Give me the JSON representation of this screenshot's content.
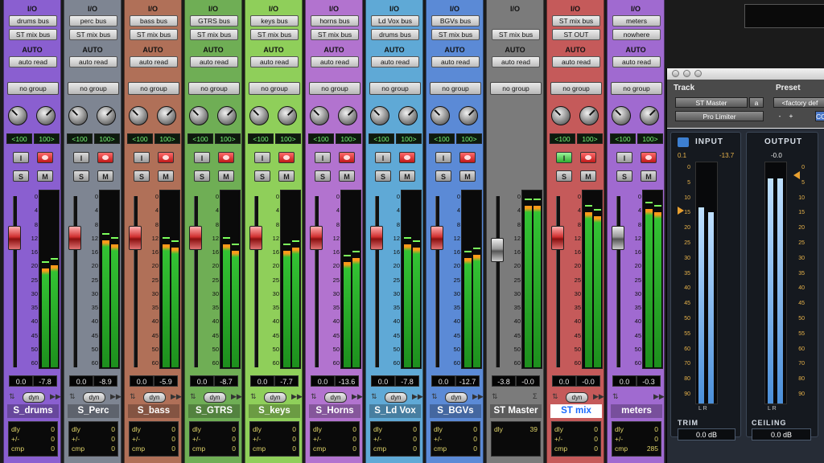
{
  "colors": {
    "selected_name": "#1a6bff"
  },
  "channels": [
    {
      "io": "I/O",
      "input": "drums bus",
      "output": "ST mix bus",
      "auto_label": "AUTO",
      "auto_mode": "auto read",
      "group": "no group",
      "pan_l": "<100",
      "pan_r": "100>",
      "vol": "0.0",
      "peak": "-7.8",
      "name": "S_drums",
      "dly": "0",
      "plus": "0",
      "cmp": "0",
      "color": "#8a5fd0",
      "rec": true,
      "inp_active": false,
      "fader": "red",
      "meter_level": [
        0.56,
        0.58
      ],
      "dyn": "dyn"
    },
    {
      "io": "I/O",
      "input": "perc bus",
      "output": "ST mix bus",
      "auto_label": "AUTO",
      "auto_mode": "auto read",
      "group": "no group",
      "pan_l": "<100",
      "pan_r": "100>",
      "vol": "0.0",
      "peak": "-8.9",
      "name": "S_Perc",
      "dly": "0",
      "plus": "0",
      "cmp": "0",
      "color": "#7e8592",
      "rec": true,
      "inp_active": false,
      "fader": "red",
      "meter_level": [
        0.72,
        0.7
      ],
      "dyn": "dyn"
    },
    {
      "io": "I/O",
      "input": "bass bus",
      "output": "ST mix bus",
      "auto_label": "AUTO",
      "auto_mode": "auto read",
      "group": "no group",
      "pan_l": "<100",
      "pan_r": "100>",
      "vol": "0.0",
      "peak": "-5.9",
      "name": "S_bass",
      "dly": "0",
      "plus": "0",
      "cmp": "0",
      "color": "#b07058",
      "rec": true,
      "inp_active": false,
      "fader": "red",
      "meter_level": [
        0.7,
        0.68
      ],
      "dyn": "dyn"
    },
    {
      "io": "I/O",
      "input": "GTRS bus",
      "output": "ST mix bus",
      "auto_label": "AUTO",
      "auto_mode": "auto read",
      "group": "no group",
      "pan_l": "<100",
      "pan_r": "100>",
      "vol": "0.0",
      "peak": "-8.7",
      "name": "S_GTRS",
      "dly": "0",
      "plus": "0",
      "cmp": "0",
      "color": "#6fae55",
      "rec": true,
      "inp_active": false,
      "fader": "red",
      "meter_level": [
        0.7,
        0.66
      ],
      "dyn": "dyn"
    },
    {
      "io": "I/O",
      "input": "keys bus",
      "output": "ST mix bus",
      "auto_label": "AUTO",
      "auto_mode": "auto read",
      "group": "no group",
      "pan_l": "<100",
      "pan_r": "100>",
      "vol": "0.0",
      "peak": "-7.7",
      "name": "S_keys",
      "dly": "0",
      "plus": "0",
      "cmp": "0",
      "color": "#8fcf5a",
      "rec": true,
      "inp_active": false,
      "fader": "red",
      "meter_level": [
        0.66,
        0.68
      ],
      "dyn": "dyn"
    },
    {
      "io": "I/O",
      "input": "horns bus",
      "output": "ST mix bus",
      "auto_label": "AUTO",
      "auto_mode": "auto read",
      "group": "no group",
      "pan_l": "<100",
      "pan_r": "100>",
      "vol": "0.0",
      "peak": "-13.6",
      "name": "S_Horns",
      "dly": "0",
      "plus": "0",
      "cmp": "0",
      "color": "#b273cf",
      "rec": true,
      "inp_active": false,
      "fader": "red",
      "meter_level": [
        0.6,
        0.62
      ],
      "dyn": "dyn"
    },
    {
      "io": "I/O",
      "input": "Ld Vox bus",
      "output": "drums bus",
      "auto_label": "AUTO",
      "auto_mode": "auto read",
      "group": "no group",
      "pan_l": "<100",
      "pan_r": "100>",
      "vol": "0.0",
      "peak": "-7.8",
      "name": "S_Ld Vox",
      "dly": "0",
      "plus": "0",
      "cmp": "0",
      "color": "#5fa9d6",
      "rec": true,
      "inp_active": false,
      "fader": "red",
      "meter_level": [
        0.7,
        0.68
      ],
      "dyn": "dyn"
    },
    {
      "io": "I/O",
      "input": "BGVs bus",
      "output": "ST mix bus",
      "auto_label": "AUTO",
      "auto_mode": "auto read",
      "group": "no group",
      "pan_l": "<100",
      "pan_r": "100>",
      "vol": "0.0",
      "peak": "-12.7",
      "name": "S_BGVs",
      "dly": "0",
      "plus": "0",
      "cmp": "0",
      "color": "#5b8ad6",
      "rec": true,
      "inp_active": false,
      "fader": "red",
      "meter_level": [
        0.62,
        0.64
      ],
      "dyn": "dyn"
    },
    {
      "io": "I/O",
      "input": "",
      "output": "ST mix bus",
      "auto_label": "AUTO",
      "auto_mode": "auto read",
      "group": "no group",
      "pan_l": "",
      "pan_r": "",
      "vol": "-3.8",
      "peak": "-0.0",
      "name": "ST Master",
      "dly": "39",
      "plus": "",
      "cmp": "",
      "color": "#7b7b7b",
      "rec": false,
      "inp_active": false,
      "fader": "gray",
      "meter_level": [
        0.92,
        0.92
      ],
      "dyn": ""
    },
    {
      "io": "I/O",
      "input": "ST mix bus",
      "output": "ST OUT",
      "auto_label": "AUTO",
      "auto_mode": "auto read",
      "group": "no group",
      "pan_l": "<100",
      "pan_r": "100>",
      "vol": "0.0",
      "peak": "-0.0",
      "name": "ST mix",
      "dly": "0",
      "plus": "0",
      "cmp": "0",
      "color": "#c55a5a",
      "rec": true,
      "inp_active": true,
      "fader": "red",
      "meter_level": [
        0.88,
        0.86
      ],
      "dyn": "dyn"
    },
    {
      "io": "I/O",
      "input": "meters",
      "output": "nowhere",
      "auto_label": "AUTO",
      "auto_mode": "auto read",
      "group": "no group",
      "pan_l": "<100",
      "pan_r": "100>",
      "vol": "0.0",
      "peak": "-0.3",
      "name": "meters",
      "dly": "0",
      "plus": "0",
      "cmp": "285",
      "color": "#a06ad0",
      "rec": true,
      "inp_active": false,
      "fader": "gray",
      "meter_level": [
        0.9,
        0.88
      ],
      "dyn": ""
    }
  ],
  "labels": {
    "solo": "S",
    "mute": "M",
    "inp": "I",
    "dly": "dly",
    "plus": "+/-",
    "cmp": "cmp"
  },
  "scale": [
    "0",
    "4",
    "8",
    "12",
    "16",
    "20",
    "25",
    "30",
    "35",
    "40",
    "45",
    "50",
    "60"
  ],
  "plugin": {
    "track_label": "Track",
    "preset_label": "Preset",
    "track_name": "ST Master",
    "track_suffix": "a",
    "plugin_name": "Pro Limiter",
    "preset_name": "<factory def",
    "input_title": "INPUT",
    "output_title": "OUTPUT",
    "input_peak_l": "0.1",
    "input_peak_r": "-13.7",
    "output_peak": "-0.0",
    "input_bars": [
      0.82,
      0.8
    ],
    "output_bars": [
      0.94,
      0.94
    ],
    "trim_label": "TRIM",
    "trim_value": "0.0 dB",
    "ceiling_label": "CEILING",
    "ceiling_value": "0.0 dB",
    "lr": "L R",
    "minus": "-",
    "plus": "+",
    "co": "CO"
  }
}
